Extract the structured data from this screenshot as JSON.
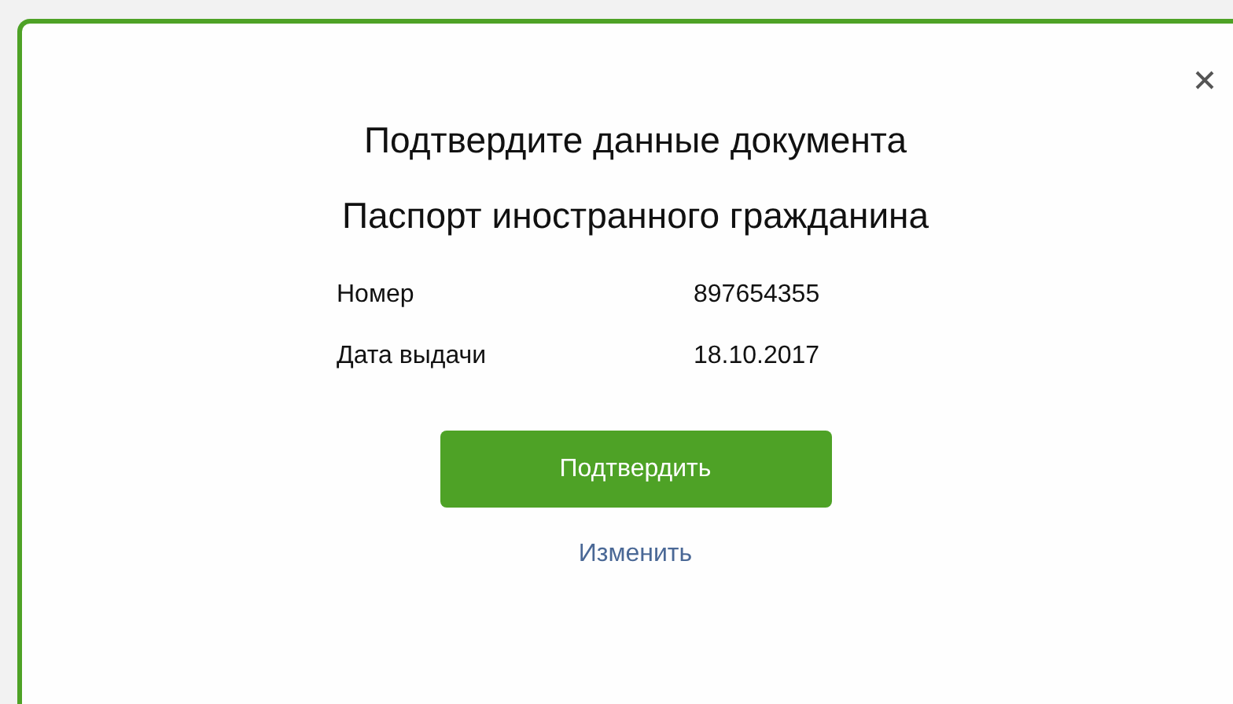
{
  "dialog": {
    "title": "Подтвердите данные документа",
    "subtitle": "Паспорт иностранного гражданина",
    "fields": [
      {
        "label": "Номер",
        "value": "897654355"
      },
      {
        "label": "Дата выдачи",
        "value": "18.10.2017"
      }
    ],
    "confirm_button": "Подтвердить",
    "change_link": "Изменить"
  }
}
